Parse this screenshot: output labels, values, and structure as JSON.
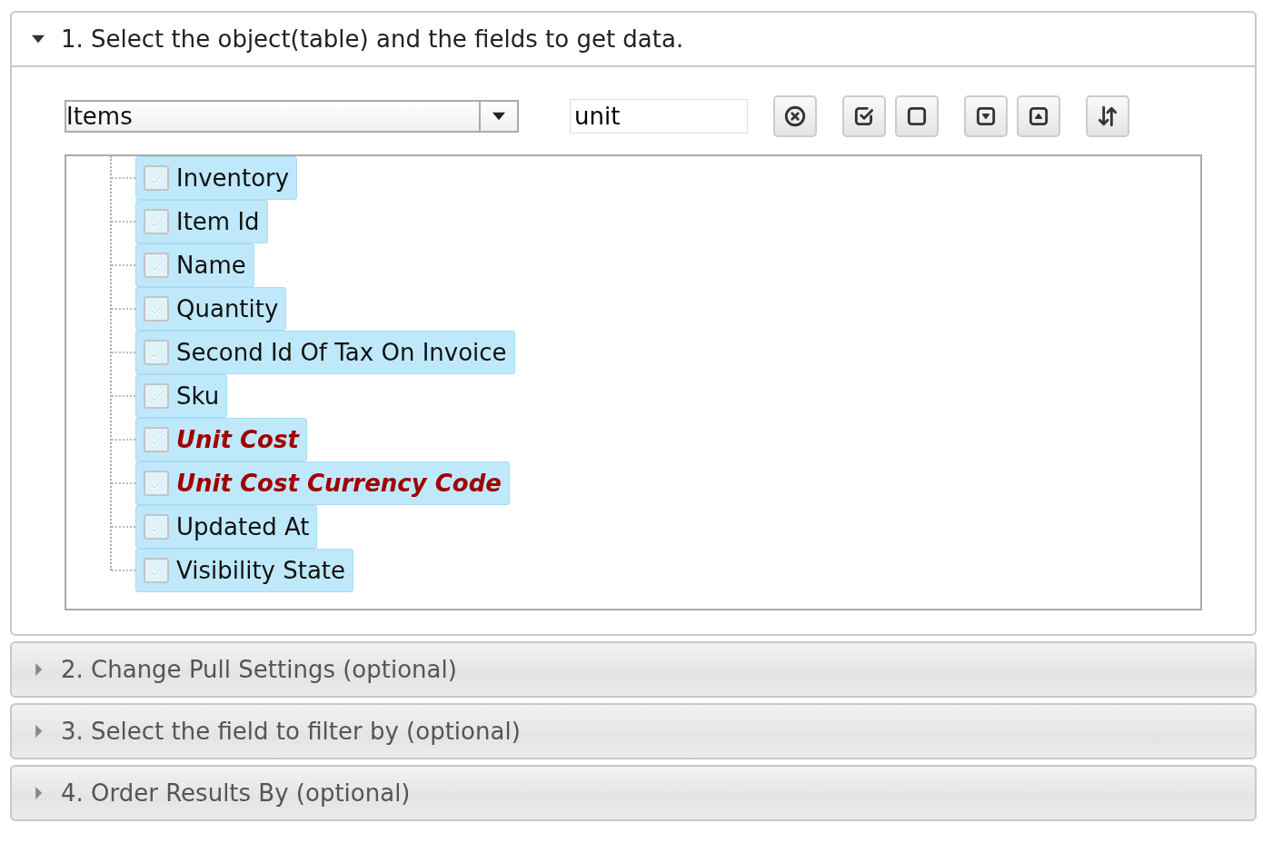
{
  "sections": [
    {
      "title": "1. Select the object(table) and the fields to get data.",
      "expanded": true,
      "object_select": {
        "value": "Items"
      },
      "search": {
        "value": "unit"
      },
      "fields": [
        {
          "label": "Inventory",
          "checked": true,
          "selected": true,
          "match": false
        },
        {
          "label": "Item Id",
          "checked": true,
          "selected": true,
          "match": false
        },
        {
          "label": "Name",
          "checked": true,
          "selected": true,
          "match": false
        },
        {
          "label": "Quantity",
          "checked": true,
          "selected": true,
          "match": false
        },
        {
          "label": "Second Id Of Tax On Invoice",
          "checked": true,
          "selected": true,
          "match": false
        },
        {
          "label": "Sku",
          "checked": true,
          "selected": true,
          "match": false
        },
        {
          "label": "Unit Cost",
          "checked": true,
          "selected": true,
          "match": true
        },
        {
          "label": "Unit Cost Currency Code",
          "checked": true,
          "selected": true,
          "match": true
        },
        {
          "label": "Updated At",
          "checked": true,
          "selected": true,
          "match": false
        },
        {
          "label": "Visibility State",
          "checked": true,
          "selected": true,
          "match": false
        }
      ]
    },
    {
      "title": "2. Change Pull Settings (optional)",
      "expanded": false
    },
    {
      "title": "3. Select the field to filter by (optional)",
      "expanded": false
    },
    {
      "title": "4. Order Results By (optional)",
      "expanded": false
    }
  ]
}
